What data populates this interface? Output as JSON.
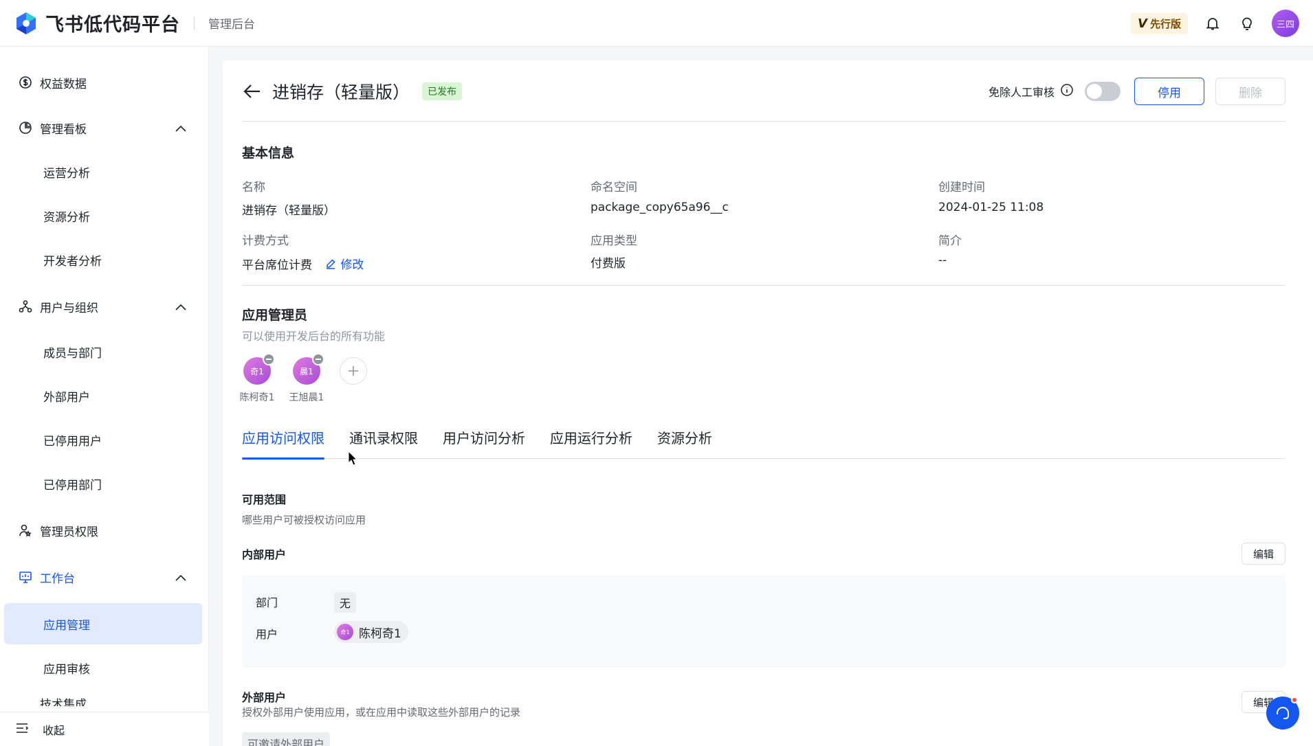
{
  "topbar": {
    "brand": "飞书低代码平台",
    "sub": "管理后台",
    "vip_letter": "V",
    "vip_label": "先行版",
    "avatar_text": "三四"
  },
  "sidebar": {
    "items": [
      {
        "label": "权益数据",
        "icon": "dollar-icon"
      },
      {
        "label": "管理看板",
        "icon": "pie-chart-icon"
      },
      {
        "label": "运营分析"
      },
      {
        "label": "资源分析"
      },
      {
        "label": "开发者分析"
      },
      {
        "label": "用户与组织",
        "icon": "org-icon"
      },
      {
        "label": "成员与部门"
      },
      {
        "label": "外部用户"
      },
      {
        "label": "已停用用户"
      },
      {
        "label": "已停用部门"
      },
      {
        "label": "管理员权限",
        "icon": "admin-icon"
      },
      {
        "label": "工作台",
        "icon": "monitor-icon"
      },
      {
        "label": "应用管理"
      },
      {
        "label": "应用审核"
      },
      {
        "label": "技术集成"
      }
    ],
    "collapse_label": "收起"
  },
  "header": {
    "title": "进销存（轻量版）",
    "status": "已发布",
    "review_label": "免除人工审核",
    "disable_label": "停用",
    "delete_label": "删除"
  },
  "basic": {
    "title": "基本信息",
    "name_label": "名称",
    "name_value": "进销存（轻量版）",
    "namespace_label": "命名空间",
    "namespace_value": "package_copy65a96__c",
    "created_label": "创建时间",
    "created_value": "2024-01-25 11:08",
    "billing_label": "计费方式",
    "billing_value": "平台席位计费",
    "edit_label": "修改",
    "type_label": "应用类型",
    "type_value": "付费版",
    "intro_label": "简介",
    "intro_value": "--"
  },
  "admins": {
    "title": "应用管理员",
    "desc": "可以使用开发后台的所有功能",
    "list": [
      {
        "avatar": "奇1",
        "name": "陈柯奇1"
      },
      {
        "avatar": "晨1",
        "name": "王旭晨1"
      }
    ]
  },
  "tabs": [
    "应用访问权限",
    "通讯录权限",
    "用户访问分析",
    "应用运行分析",
    "资源分析"
  ],
  "access": {
    "scope_title": "可用范围",
    "scope_desc": "哪些用户可被授权访问应用",
    "internal_title": "内部用户",
    "edit_label": "编辑",
    "dept_label": "部门",
    "dept_value": "无",
    "user_label": "用户",
    "user_avatar": "奇1",
    "user_value": "陈柯奇1",
    "external_title": "外部用户",
    "external_desc": "授权外部用户使用应用，或在应用中读取这些外部用户的记录",
    "external_tag": "可邀请外部用户"
  },
  "colors": {
    "primary": "#1456f0",
    "published_bg": "#d9f5d6",
    "published_text": "#237b19"
  }
}
